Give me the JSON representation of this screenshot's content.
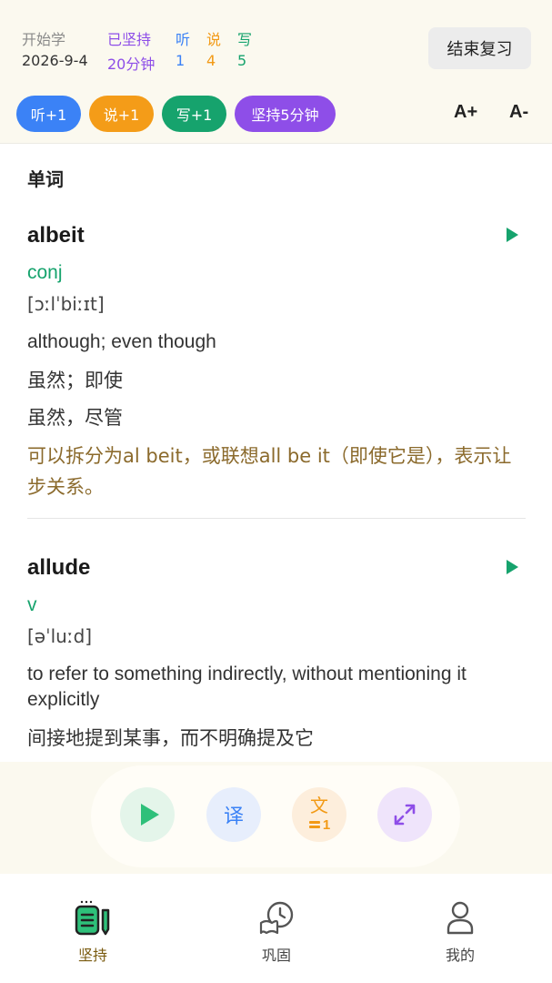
{
  "header": {
    "start_label": "开始学",
    "start_date": "2026-9-4",
    "persisted_label": "已坚持",
    "persisted_value": "20分钟",
    "listen_label": "听",
    "listen_count": "1",
    "speak_label": "说",
    "speak_count": "4",
    "write_label": "写",
    "write_count": "5",
    "end_review_button": "结束复习"
  },
  "pills": {
    "listen": "听+1",
    "speak": "说+1",
    "write": "写+1",
    "persist": "坚持5分钟"
  },
  "font_controls": {
    "increase": "A+",
    "decrease": "A-"
  },
  "section_title": "单词",
  "words": [
    {
      "word": "albeit",
      "pos": "conj",
      "phonetic": "[ɔːlˈbiːɪt]",
      "definition_en": "although; even though",
      "definition_cn_1": "虽然；即使",
      "definition_cn_2": "虽然，尽管",
      "memo": "可以拆分为al beit，或联想all be it（即使它是），表示让步关系。"
    },
    {
      "word": "allude",
      "pos": "v",
      "phonetic": "[əˈluːd]",
      "definition_en": "to refer to something indirectly, without mentioning it explicitly",
      "definition_cn_1": "间接地提到某事，而不明确提及它"
    }
  ],
  "toolbar": {
    "translate_label": "译",
    "text_label": "文",
    "text_count": "1"
  },
  "tabbar": {
    "tabs": [
      {
        "label": "坚持",
        "icon": "notebook-icon",
        "active": true
      },
      {
        "label": "巩固",
        "icon": "book-clock-icon",
        "active": false
      },
      {
        "label": "我的",
        "icon": "person-icon",
        "active": false
      }
    ]
  },
  "colors": {
    "accent_green": "#16a36d",
    "listen_blue": "#3b82f6",
    "speak_orange": "#f49c18",
    "persist_purple": "#8e4ee8",
    "memo_brown": "#8b6a2c",
    "active_tab": "#7a5b10"
  }
}
